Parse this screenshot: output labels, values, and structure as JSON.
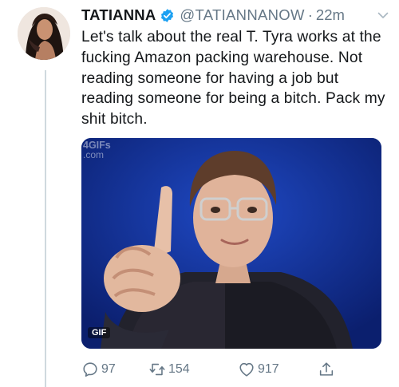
{
  "tweet": {
    "display_name": "TATIANNA",
    "handle": "@TATIANNANOW",
    "separator": "·",
    "time": "22m",
    "text": "Let's talk about the real T. Tyra works at the fucking Amazon packing warehouse. Not reading someone for having a job but reading someone for being a bitch. Pack my shit bitch.",
    "media": {
      "watermark_main": "4GIFs",
      "watermark_sub": ".com",
      "badge": "GIF"
    },
    "actions": {
      "replies": "97",
      "retweets": "154",
      "likes": "917"
    }
  },
  "icons": {
    "verified": "verified-badge-icon",
    "caret": "chevron-down-icon",
    "reply": "reply-icon",
    "retweet": "retweet-icon",
    "like": "heart-icon",
    "share": "share-icon"
  },
  "colors": {
    "verified": "#1da1f2",
    "secondary_text": "#657786",
    "gif_background": "#0f2a82"
  }
}
